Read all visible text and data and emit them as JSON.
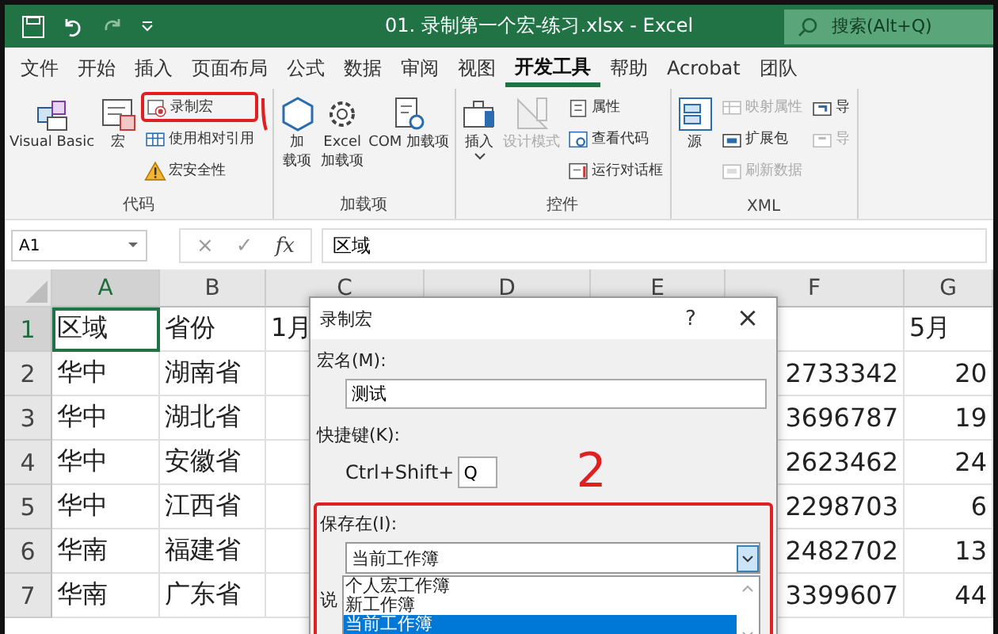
{
  "window": {
    "title": "01. 录制第一个宏-练习.xlsx - Excel"
  },
  "search": {
    "placeholder": "搜索(Alt+Q)"
  },
  "tabs": [
    {
      "label": "文件",
      "selected": false
    },
    {
      "label": "开始",
      "selected": false
    },
    {
      "label": "插入",
      "selected": false
    },
    {
      "label": "页面布局",
      "selected": false
    },
    {
      "label": "公式",
      "selected": false
    },
    {
      "label": "数据",
      "selected": false
    },
    {
      "label": "审阅",
      "selected": false
    },
    {
      "label": "视图",
      "selected": false
    },
    {
      "label": "开发工具",
      "selected": true
    },
    {
      "label": "帮助",
      "selected": false
    },
    {
      "label": "Acrobat",
      "selected": false
    },
    {
      "label": "团队",
      "selected": false
    }
  ],
  "ribbon": {
    "groups": [
      {
        "label": "代码",
        "items": [
          {
            "kind": "large",
            "lines": [
              "Visual Basic"
            ],
            "disabled": false
          },
          {
            "kind": "large",
            "lines": [
              "宏"
            ],
            "disabled": false
          },
          {
            "kind": "small",
            "label": "录制宏",
            "disabled": false,
            "marked": true
          },
          {
            "kind": "small",
            "label": "使用相对引用",
            "disabled": false,
            "marked": false
          },
          {
            "kind": "small",
            "label": "宏安全性",
            "disabled": false,
            "marked": false
          }
        ]
      },
      {
        "label": "加载项",
        "items": [
          {
            "kind": "large",
            "lines": [
              "加",
              "载项"
            ],
            "disabled": false
          },
          {
            "kind": "large",
            "lines": [
              "Excel",
              "加载项"
            ],
            "disabled": false
          },
          {
            "kind": "large",
            "lines": [
              "COM 加载项"
            ],
            "disabled": false
          }
        ]
      },
      {
        "label": "控件",
        "items": [
          {
            "kind": "large",
            "lines": [
              "插入"
            ],
            "disabled": false,
            "dropdown": true
          },
          {
            "kind": "large",
            "lines": [
              "设计模式"
            ],
            "disabled": true
          },
          {
            "kind": "small",
            "label": "属性",
            "disabled": false,
            "marked": false
          },
          {
            "kind": "small",
            "label": "查看代码",
            "disabled": false,
            "marked": false
          },
          {
            "kind": "small",
            "label": "运行对话框",
            "disabled": false,
            "marked": false
          }
        ]
      },
      {
        "label": "XML",
        "items": [
          {
            "kind": "large",
            "lines": [
              "源"
            ],
            "disabled": false
          },
          {
            "kind": "small",
            "label": "映射属性",
            "disabled": true,
            "marked": false
          },
          {
            "kind": "small",
            "label": "扩展包",
            "disabled": false,
            "marked": false
          },
          {
            "kind": "small",
            "label": "刷新数据",
            "disabled": true,
            "marked": false
          },
          {
            "kind": "small",
            "label": "导",
            "disabled": false,
            "marked": false
          },
          {
            "kind": "small",
            "label": "导",
            "disabled": true,
            "marked": false
          }
        ]
      }
    ]
  },
  "formula_bar": {
    "name_box": "A1",
    "cancel": "×",
    "enter": "✓",
    "function": "fx",
    "value": "区域"
  },
  "sheet": {
    "columns": [
      {
        "label": "A"
      },
      {
        "label": "B"
      },
      {
        "label": "C"
      },
      {
        "label": "D"
      },
      {
        "label": "E"
      },
      {
        "label": "F"
      },
      {
        "label": "G"
      }
    ],
    "rows": [
      {
        "number": "1",
        "kind": "header",
        "cells": [
          "区域",
          "省份",
          "1月",
          null,
          null,
          null,
          "5月"
        ]
      },
      {
        "number": "2",
        "kind": "data",
        "cells": [
          "华中",
          "湖南省",
          null,
          null,
          null,
          "2733342",
          "20"
        ]
      },
      {
        "number": "3",
        "kind": "data",
        "cells": [
          "华中",
          "湖北省",
          null,
          null,
          null,
          "3696787",
          "19"
        ]
      },
      {
        "number": "4",
        "kind": "data",
        "cells": [
          "华中",
          "安徽省",
          null,
          null,
          null,
          "2623462",
          "24"
        ]
      },
      {
        "number": "5",
        "kind": "data",
        "cells": [
          "华中",
          "江西省",
          null,
          null,
          null,
          "2298703",
          "6"
        ]
      },
      {
        "number": "6",
        "kind": "data",
        "cells": [
          "华南",
          "福建省",
          null,
          null,
          null,
          "2482702",
          "13"
        ]
      },
      {
        "number": "7",
        "kind": "data",
        "cells": [
          "华南",
          "广东省",
          null,
          null,
          null,
          "3399607",
          "44"
        ]
      }
    ]
  },
  "dialog": {
    "title": "录制宏",
    "help": "?",
    "close": "×",
    "macro_name": {
      "label": "宏名(M):",
      "value": "测试"
    },
    "shortcut": {
      "label": "快捷键(K):",
      "prefix": "Ctrl+Shift+",
      "value": "Q"
    },
    "store_in": {
      "label": "保存在(I):",
      "value": "当前工作簿",
      "marked": true,
      "options": [
        {
          "label": "个人宏工作簿",
          "selected": false
        },
        {
          "label": "新工作簿",
          "selected": false
        },
        {
          "label": "当前工作簿",
          "selected": true
        }
      ]
    },
    "description": {
      "label": "说"
    }
  },
  "annotation": {
    "text": "2"
  }
}
